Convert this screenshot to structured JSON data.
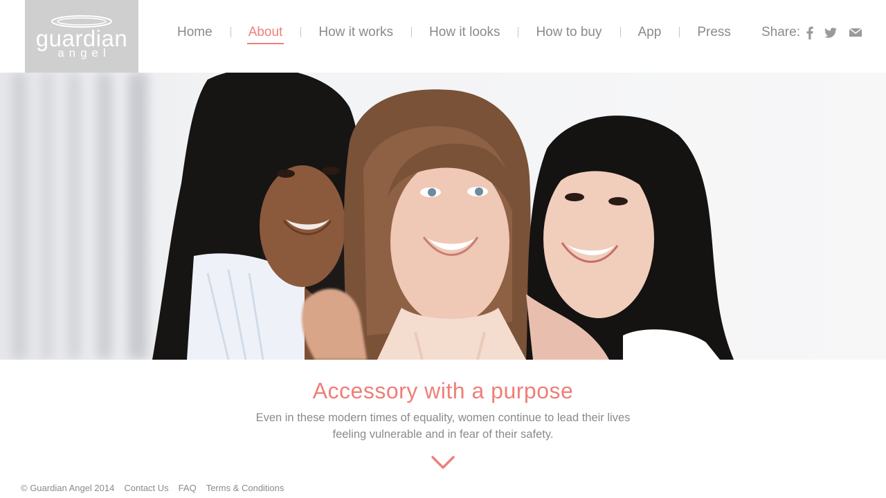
{
  "brand": {
    "logo_word": "guardian",
    "logo_sub": "angel",
    "accent_color": "#ee7f78",
    "logo_bg": "#cfcfcf"
  },
  "nav": {
    "items": [
      {
        "label": "Home",
        "active": false
      },
      {
        "label": "About",
        "active": true
      },
      {
        "label": "How it works",
        "active": false
      },
      {
        "label": "How it looks",
        "active": false
      },
      {
        "label": "How to buy",
        "active": false
      },
      {
        "label": "App",
        "active": false
      },
      {
        "label": "Press",
        "active": false
      }
    ]
  },
  "share": {
    "label": "Share:",
    "icons": [
      "facebook-icon",
      "twitter-icon",
      "mail-icon"
    ]
  },
  "hero": {
    "image": "three-smiling-women-photo"
  },
  "content": {
    "headline": "Accessory with a purpose",
    "body": "Even in these modern times of equality, women continue to lead their lives feeling vulnerable and in fear of their safety.",
    "scroll_icon": "chevron-down-icon"
  },
  "footer": {
    "copyright": "© Guardian Angel 2014",
    "links": [
      "Contact Us",
      "FAQ",
      "Terms & Conditions"
    ]
  }
}
